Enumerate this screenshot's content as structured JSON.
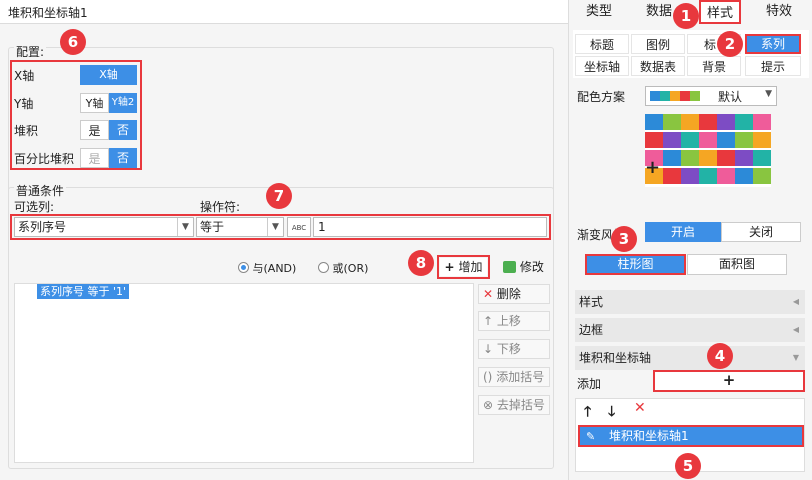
{
  "window": {
    "title": "堆积和坐标轴1"
  },
  "config": {
    "legend": "配置:",
    "rows": [
      {
        "label": "X轴",
        "options": [
          "X轴"
        ],
        "selected": 0
      },
      {
        "label": "Y轴",
        "options": [
          "Y轴",
          "Y轴2"
        ],
        "selected": 1
      },
      {
        "label": "堆积",
        "options": [
          "是",
          "否"
        ],
        "selected": 1
      },
      {
        "label": "百分比堆积",
        "options": [
          "是",
          "否"
        ],
        "selected": 1
      }
    ]
  },
  "condition": {
    "legend": "普通条件",
    "column_label": "可选列:",
    "operator_label": "操作符:",
    "column_value": "系列序号",
    "operator_value": "等于",
    "abc_label": "ABC",
    "value": "1",
    "radio_and": "与(AND)",
    "radio_or": "或(OR)",
    "add_label": "增加",
    "modify_label": "修改",
    "list_items": [
      "系列序号 等于 '1'"
    ],
    "delete_label": "删除",
    "up_label": "上移",
    "down_label": "下移",
    "add_bracket_label": "添加括号",
    "remove_bracket_label": "去掉括号"
  },
  "right": {
    "tabs": [
      "类型",
      "数据",
      "样式",
      "特效"
    ],
    "active_tab": "样式",
    "subtabs_row1": [
      "标题",
      "图例",
      "标",
      "系列"
    ],
    "subtabs_row2": [
      "坐标轴",
      "数据表",
      "背景",
      "提示"
    ],
    "active_subtab": "系列",
    "color_scheme_label": "配色方案",
    "color_scheme_value": "默认",
    "gradient_label": "渐变风格",
    "gradient_on": "开启",
    "gradient_off": "关闭",
    "chart_type_bar": "柱形图",
    "chart_type_area": "面积图",
    "sections": [
      "样式",
      "边框",
      "堆积和坐标轴"
    ],
    "add_label": "添加",
    "add_plus": "+",
    "list_item": "堆积和坐标轴1",
    "palette": [
      "#2c8ad8",
      "#89c540",
      "#f5a623",
      "#e8383d",
      "#7d4cc4",
      "#22b3a6",
      "#ef5c9a"
    ]
  },
  "badges": [
    "1",
    "2",
    "3",
    "4",
    "5",
    "6",
    "7",
    "8"
  ]
}
